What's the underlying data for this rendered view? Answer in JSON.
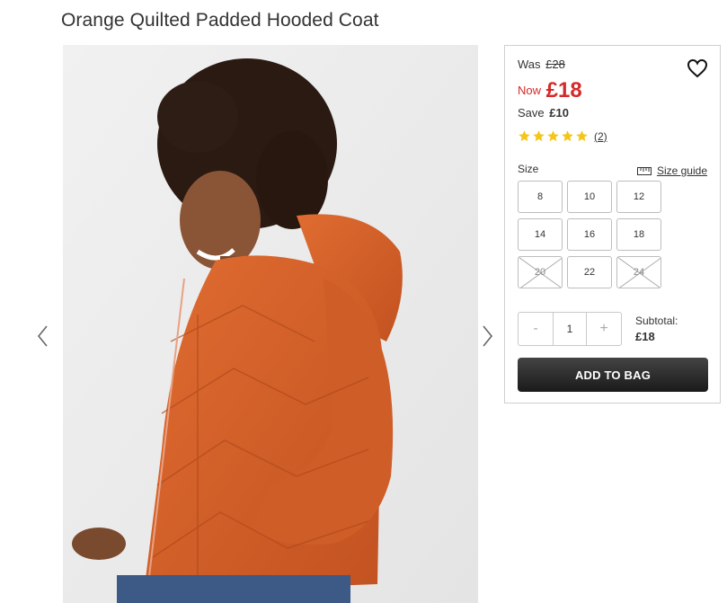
{
  "product": {
    "title": "Orange Quilted Padded Hooded Coat",
    "image_alt": "Woman wearing orange quilted padded hooded coat"
  },
  "gallery": {
    "prev_icon": "chevron-left-icon",
    "next_icon": "chevron-right-icon"
  },
  "pricing": {
    "was_label": "Was",
    "was_value": "£28",
    "now_label": "Now",
    "now_value": "£18",
    "save_label": "Save",
    "save_value": "£10"
  },
  "rating": {
    "stars": 5,
    "review_count": "(2)"
  },
  "size": {
    "label": "Size",
    "guide_label": "Size guide",
    "options": [
      {
        "label": "8",
        "available": true
      },
      {
        "label": "10",
        "available": true
      },
      {
        "label": "12",
        "available": true
      },
      {
        "label": "14",
        "available": true
      },
      {
        "label": "16",
        "available": true
      },
      {
        "label": "18",
        "available": true
      },
      {
        "label": "20",
        "available": false
      },
      {
        "label": "22",
        "available": true
      },
      {
        "label": "24",
        "available": false
      }
    ]
  },
  "quantity": {
    "minus": "-",
    "value": "1",
    "plus": "+"
  },
  "subtotal": {
    "label": "Subtotal:",
    "value": "£18"
  },
  "cta": {
    "add_to_bag": "ADD TO BAG"
  },
  "colors": {
    "price_red": "#d52a2a",
    "star_yellow": "#f5c518",
    "button_dark": "#222222",
    "coat_orange": "#d4612a"
  }
}
